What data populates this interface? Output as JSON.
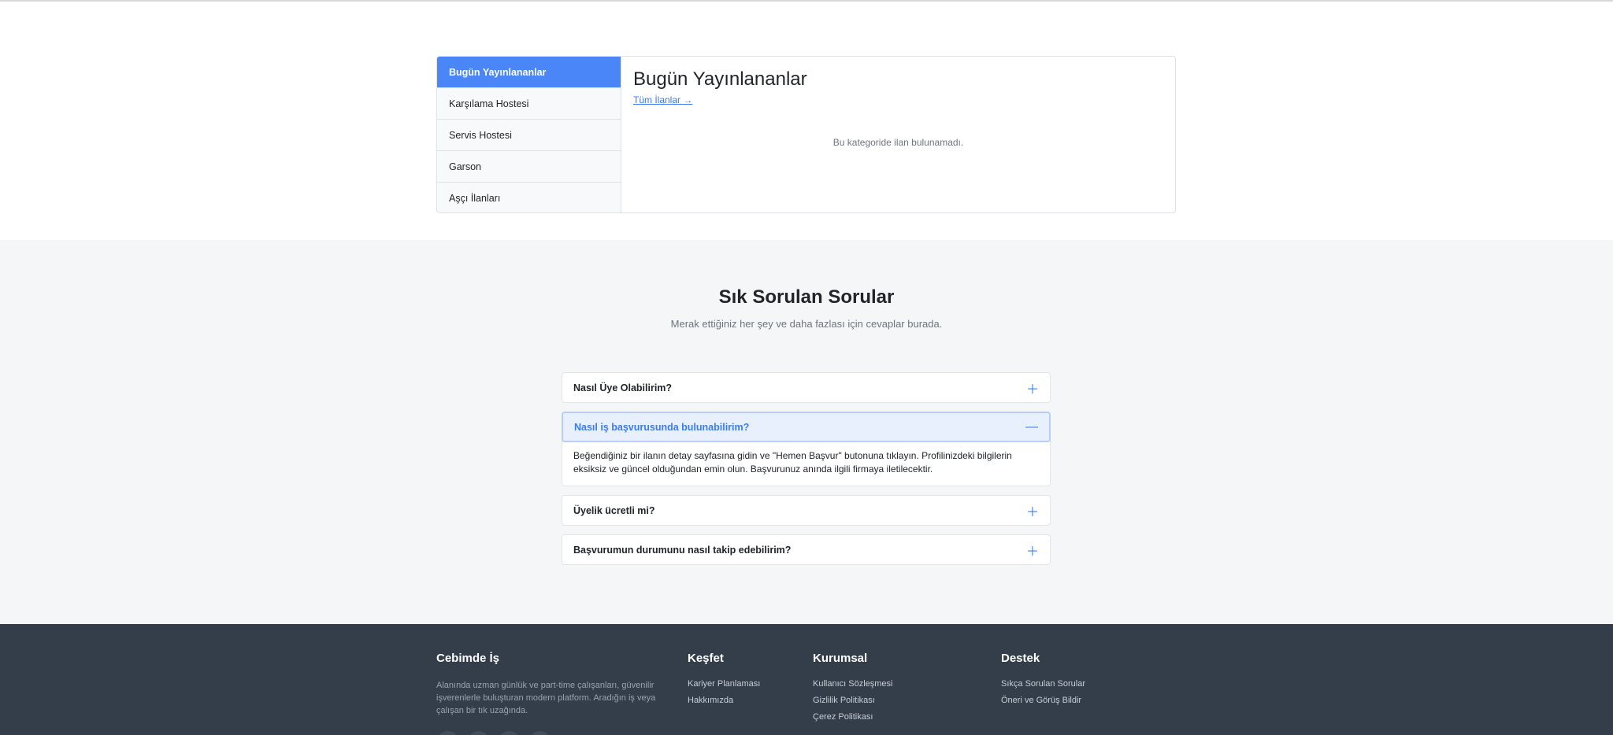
{
  "today": {
    "categories": [
      {
        "label": "Bugün Yayınlananlar",
        "active": true
      },
      {
        "label": "Karşılama Hostesi",
        "active": false
      },
      {
        "label": "Servis Hostesi",
        "active": false
      },
      {
        "label": "Garson",
        "active": false
      },
      {
        "label": "Aşçı İlanları",
        "active": false
      }
    ],
    "title": "Bugün Yayınlananlar",
    "all_link": "Tüm İlanlar →",
    "empty_message": "Bu kategoride ilan bulunamadı."
  },
  "faq": {
    "title": "Sık Sorulan Sorular",
    "subtitle": "Merak ettiğiniz her şey ve daha fazlası için cevaplar burada.",
    "items": [
      {
        "question": "Nasıl Üye Olabilirim?",
        "icon": "plus-icon"
      },
      {
        "question": "Nasıl iş başvurusunda bulunabilirim?",
        "icon": "minus-icon",
        "answer": "Beğendiğiniz bir ilanın detay sayfasına gidin ve \"Hemen Başvur\" butonuna tıklayın. Profilinizdeki bilgilerin eksiksiz ve güncel olduğundan emin olun. Başvurunuz anında ilgili firmaya iletilecektir."
      },
      {
        "question": "Üyelik ücretli mi?",
        "icon": "plus-icon"
      },
      {
        "question": "Başvurumun durumunu nasıl takip edebilirim?",
        "icon": "plus-icon"
      }
    ]
  },
  "footer": {
    "brand": {
      "title": "Cebimde İş",
      "description": "Alanında uzman günlük ve part-time çalışanları, güvenilir işverenlerle buluşturan modern platform. Aradığın iş veya çalışan bir tık uzağında."
    },
    "socials": [
      "facebook-icon",
      "twitter-icon",
      "instagram-icon",
      "linkedin-icon"
    ],
    "kesfet": {
      "title": "Keşfet",
      "links": [
        "Kariyer Planlaması",
        "Hakkımızda"
      ]
    },
    "kurumsal": {
      "title": "Kurumsal",
      "links": [
        "Kullanıcı Sözleşmesi",
        "Gizlilik Politikası",
        "Çerez Politikası"
      ]
    },
    "destek": {
      "title": "Destek",
      "links": [
        "Sıkça Sorulan Sorular",
        "Öneri ve Görüş Bildir"
      ]
    }
  },
  "colors": {
    "accent": "#4a86f7",
    "link": "#3b7cf2",
    "footer_bg": "#343d4a",
    "faq_bg": "#f5f6f7"
  }
}
